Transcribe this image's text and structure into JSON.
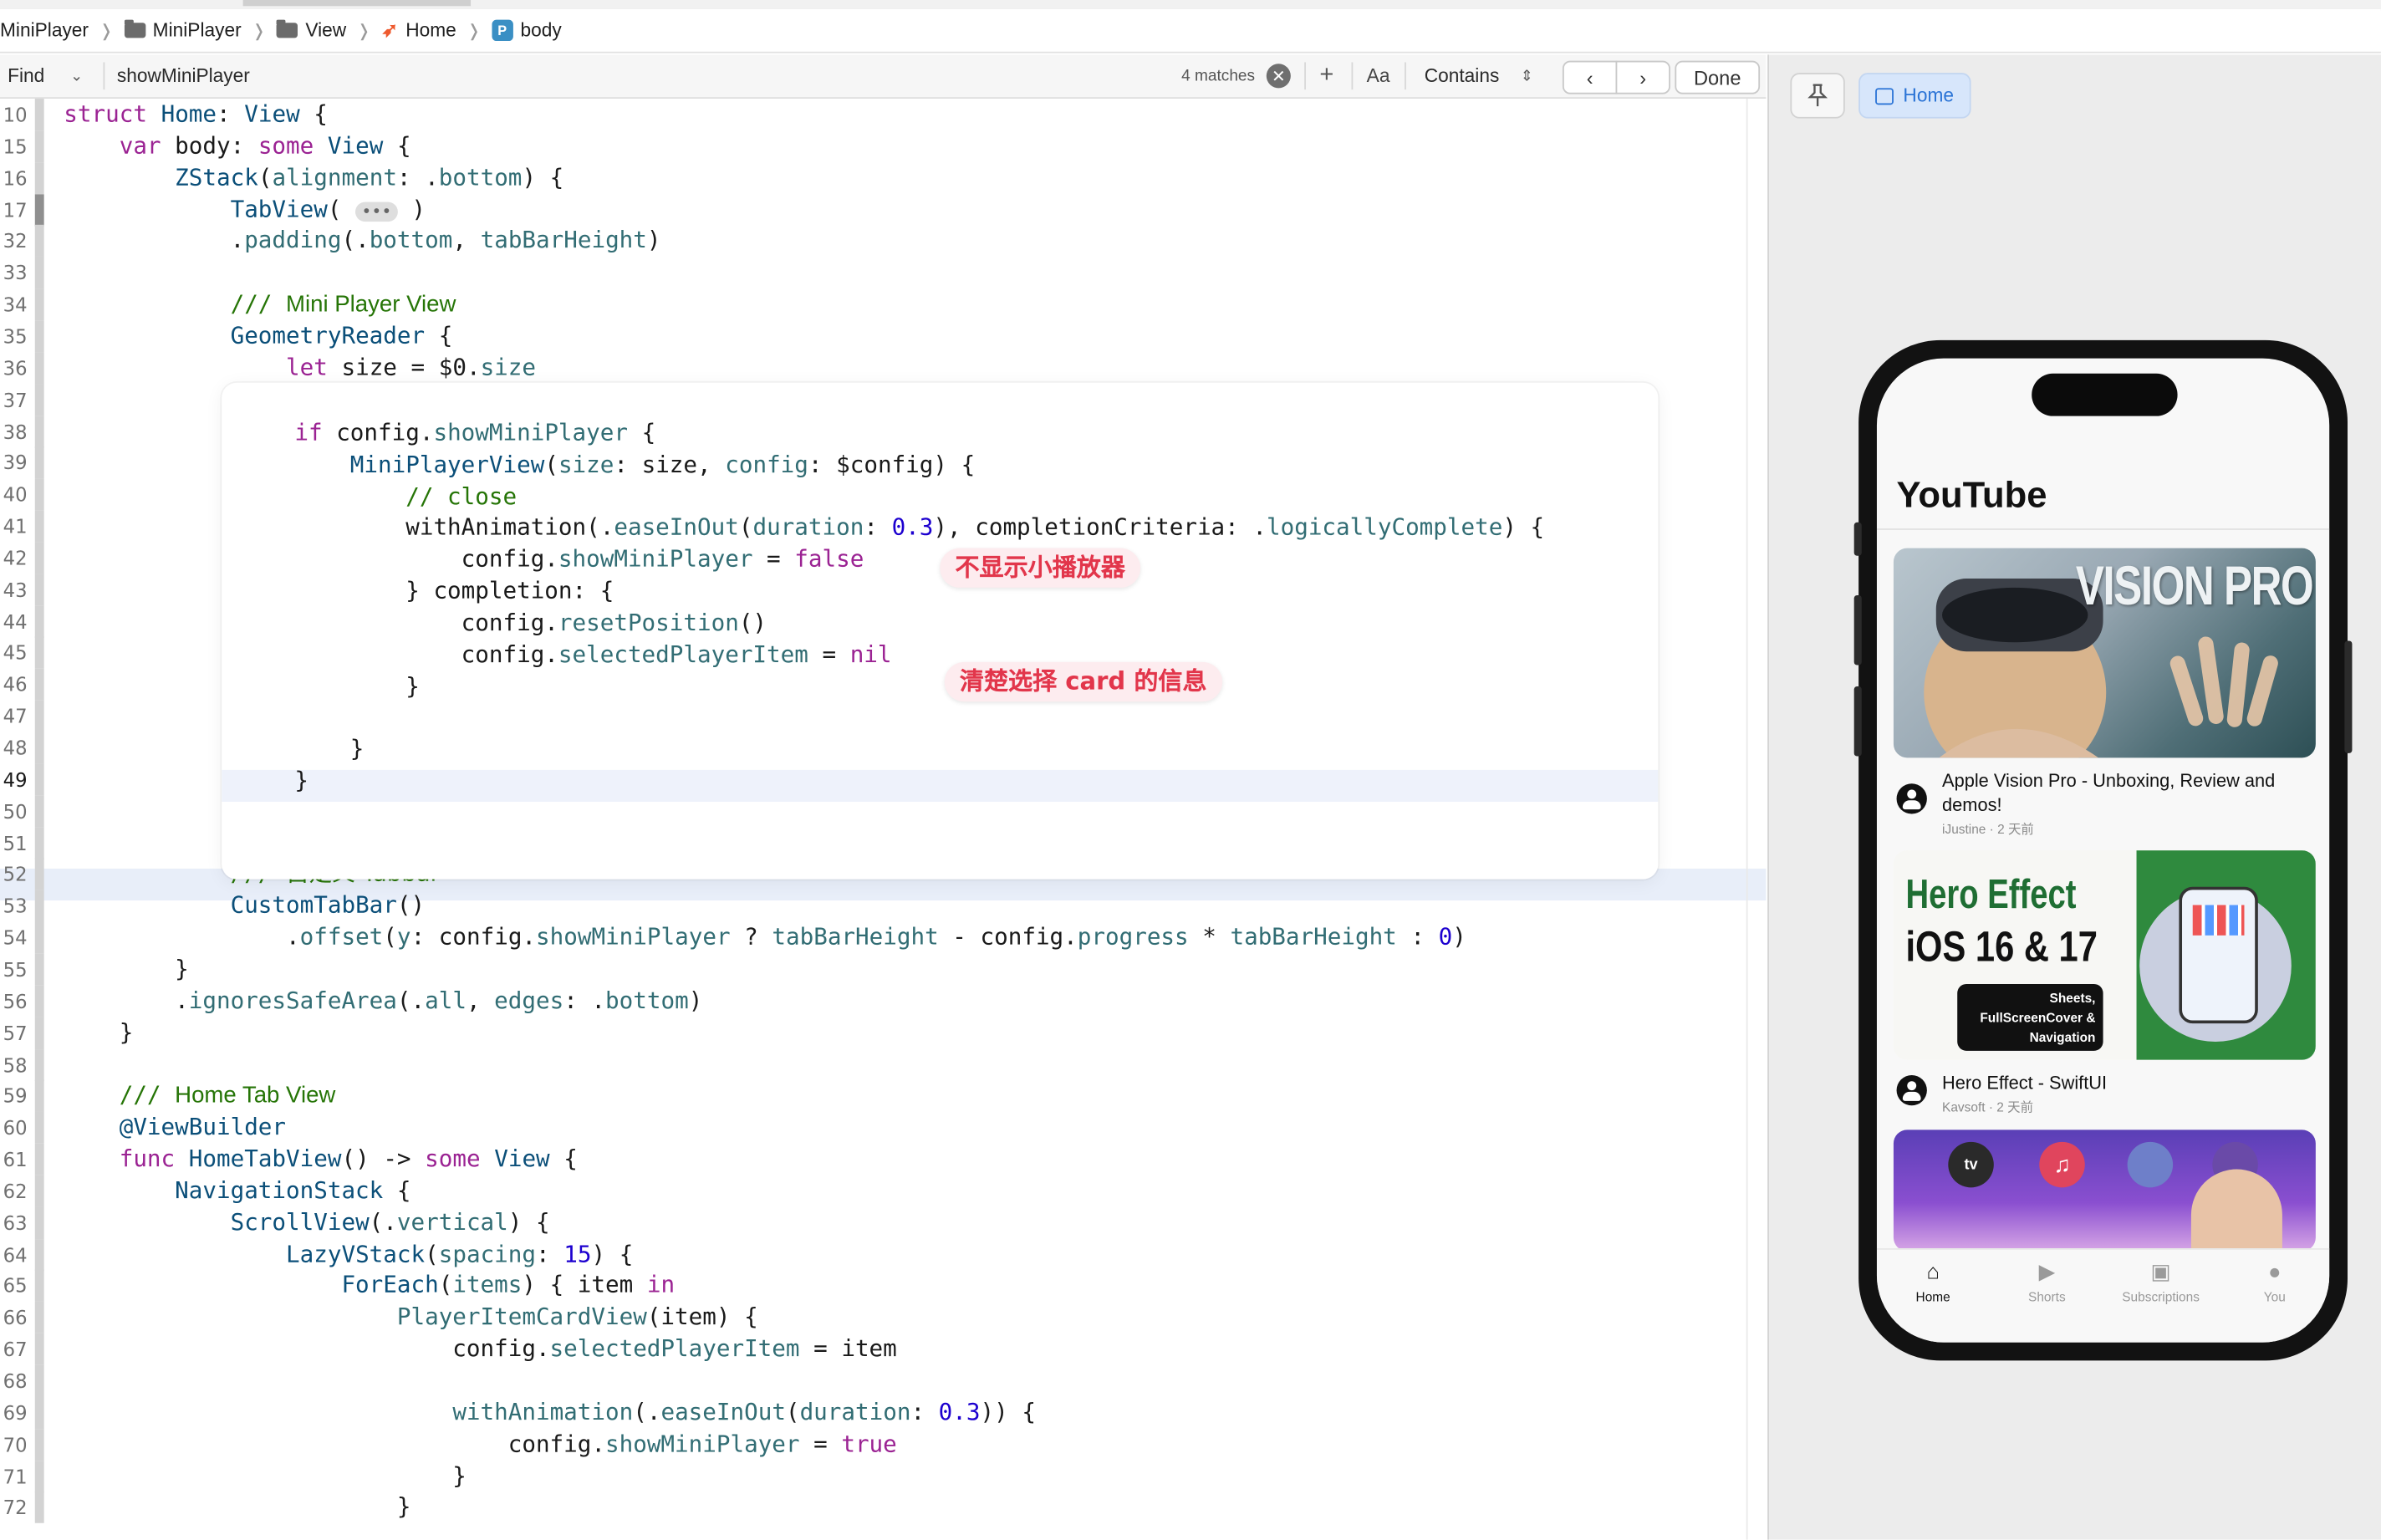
{
  "breadcrumb": {
    "items": [
      "MiniPlayer",
      "MiniPlayer",
      "View",
      "Home",
      "body"
    ],
    "body_badge": "P"
  },
  "find_bar": {
    "mode": "Find",
    "query": "showMiniPlayer",
    "match_count": "4 matches",
    "add": "+",
    "case_toggle": "Aa",
    "match_type": "Contains",
    "prev": "‹",
    "next": "›",
    "done": "Done"
  },
  "code_lines": [
    {
      "n": "10",
      "html": "<span class='kw'>struct</span> <span class='ty'>Home</span>: <span class='ty'>View</span> {"
    },
    {
      "n": "15",
      "html": "    <span class='kw'>var</span> body: <span class='kw'>some</span> <span class='ty'>View</span> {"
    },
    {
      "n": "16",
      "html": "        <span class='ty'>ZStack</span>(<span class='fn'>alignment</span>: .<span class='fn'>bottom</span>) {"
    },
    {
      "n": "17",
      "html": "            <span class='ty'>TabView</span>( <span class='fold'>•••</span> )"
    },
    {
      "n": "32",
      "html": "            .<span class='fn'>padding</span>(.<span class='fn'>bottom</span>, <span class='fn'>tabBarHeight</span>)"
    },
    {
      "n": "33",
      "html": ""
    },
    {
      "n": "34",
      "html": "            <span class='cm'>/// </span><span class='cm' style='font-family:\"Liberation Sans\",sans-serif'>Mini Player View</span>"
    },
    {
      "n": "35",
      "html": "            <span class='ty'>GeometryReader</span> {"
    },
    {
      "n": "36",
      "html": "                <span class='kw'>let</span> size = $0.<span class='fn'>size</span>"
    },
    {
      "n": "37",
      "html": ""
    },
    {
      "n": "38",
      "html": ""
    },
    {
      "n": "39",
      "html": ""
    },
    {
      "n": "40",
      "html": ""
    },
    {
      "n": "41",
      "html": ""
    },
    {
      "n": "42",
      "html": ""
    },
    {
      "n": "43",
      "html": ""
    },
    {
      "n": "44",
      "html": ""
    },
    {
      "n": "45",
      "html": ""
    },
    {
      "n": "46",
      "html": ""
    },
    {
      "n": "47",
      "html": ""
    },
    {
      "n": "48",
      "html": ""
    },
    {
      "n": "49",
      "html": ""
    },
    {
      "n": "50",
      "html": ""
    },
    {
      "n": "51",
      "html": ""
    },
    {
      "n": "52",
      "html": "            <span class='cm'>/// </span><span class='cm' style='font-family:\"DejaVu Sans\",sans-serif'>自定义 Tabbar</span>"
    },
    {
      "n": "53",
      "html": "            <span class='ty'>CustomTabBar</span>()"
    },
    {
      "n": "54",
      "html": "                .<span class='fn'>offset</span>(<span class='fn'>y</span>: config.<span class='fn'>showMiniPlayer</span> ? <span class='fn'>tabBarHeight</span> - config.<span class='fn'>progress</span> * <span class='fn'>tabBarHeight</span> : <span class='num'>0</span>)"
    },
    {
      "n": "55",
      "html": "        }"
    },
    {
      "n": "56",
      "html": "        .<span class='fn'>ignoresSafeArea</span>(.<span class='fn'>all</span>, <span class='fn'>edges</span>: .<span class='fn'>bottom</span>)"
    },
    {
      "n": "57",
      "html": "    }"
    },
    {
      "n": "58",
      "html": ""
    },
    {
      "n": "59",
      "html": "    <span class='cm'>/// </span><span class='cm' style='font-family:\"Liberation Sans\",sans-serif'>Home Tab View</span>"
    },
    {
      "n": "60",
      "html": "    <span class='ty'>@ViewBuilder</span>"
    },
    {
      "n": "61",
      "html": "    <span class='kw'>func</span> <span class='ty'>HomeTabView</span>() -> <span class='kw'>some</span> <span class='ty'>View</span> {"
    },
    {
      "n": "62",
      "html": "        <span class='ty'>NavigationStack</span> {"
    },
    {
      "n": "63",
      "html": "            <span class='ty'>ScrollView</span>(.<span class='fn'>vertical</span>) {"
    },
    {
      "n": "64",
      "html": "                <span class='ty'>LazyVStack</span>(<span class='fn'>spacing</span>: <span class='num'>15</span>) {"
    },
    {
      "n": "65",
      "html": "                    <span class='ty'>ForEach</span>(<span class='fn'>items</span>) { item <span class='kw'>in</span>"
    },
    {
      "n": "66",
      "html": "                        <span class='fn'>PlayerItemCardView</span>(item) {"
    },
    {
      "n": "67",
      "html": "                            config.<span class='fn'>selectedPlayerItem</span> = item"
    },
    {
      "n": "68",
      "html": ""
    },
    {
      "n": "69",
      "html": "                            <span class='fn'>withAnimation</span>(.<span class='fn'>easeInOut</span>(<span class='fn'>duration</span>: <span class='num'>0.3</span>)) {"
    },
    {
      "n": "70",
      "html": "                                config.<span class='fn'>showMiniPlayer</span> = <span class='kw'>true</span>"
    },
    {
      "n": "71",
      "html": "                            }"
    },
    {
      "n": "72",
      "html": "                        }"
    }
  ],
  "overlay_lines": [
    "",
    "<span class='kw'>if</span> config.<span class='fn'>showMiniPlayer</span> {",
    "    <span class='ty'>MiniPlayerView</span>(<span class='fn'>size</span>: size, <span class='fn'>config</span>: $config) {",
    "        <span class='cm'>// close</span>",
    "        withAnimation(.<span class='fn'>easeInOut</span>(<span class='fn'>duration</span>: <span class='num'>0.3</span>), completionCriteria: .<span class='fn'>logicallyComplete</span>) {",
    "            config.<span class='fn'>showMiniPlayer</span> = <span class='kw'>false</span>",
    "        } completion: {",
    "            config.<span class='fn'>resetPosition</span>()",
    "            config.<span class='fn'>selectedPlayerItem</span> = <span class='kw'>nil</span>",
    "        }",
    "",
    "    }",
    "}",
    "<span style='position:relative;left:-76px'>}</span>"
  ],
  "annotations": {
    "hide_mini_player": "不显示小播放器",
    "clear_selection": "清楚选择 card 的信息"
  },
  "preview": {
    "pin_label": "",
    "home_label": "Home",
    "app_title": "YouTube",
    "videos": [
      {
        "title": "Apple Vision Pro - Unboxing, Review and demos!",
        "meta": "iJustine · 2 天前",
        "thumb_text": "VISION PRO"
      },
      {
        "title": "Hero Effect - SwiftUI",
        "meta": "Kavsoft · 2 天前",
        "thumb_line1": "Hero Effect",
        "thumb_line2": "iOS 16 & 17",
        "thumb_badge": "Sheets,\nFullScreenCover &\nNavigation"
      },
      {
        "thumb_apps": [
          "tv"
        ]
      }
    ],
    "tabs": [
      {
        "label": "Home",
        "icon": "house-icon",
        "active": true
      },
      {
        "label": "Shorts",
        "icon": "shorts-icon",
        "active": false
      },
      {
        "label": "Subscriptions",
        "icon": "subscriptions-icon",
        "active": false
      },
      {
        "label": "You",
        "icon": "person-icon",
        "active": false
      }
    ]
  },
  "colors": {
    "keyword": "#9b2393",
    "type": "#0b4f79",
    "function": "#326d74",
    "number": "#1c00cf",
    "comment": "#267507",
    "annotation": "#e2364b",
    "accent": "#2b74d6"
  }
}
